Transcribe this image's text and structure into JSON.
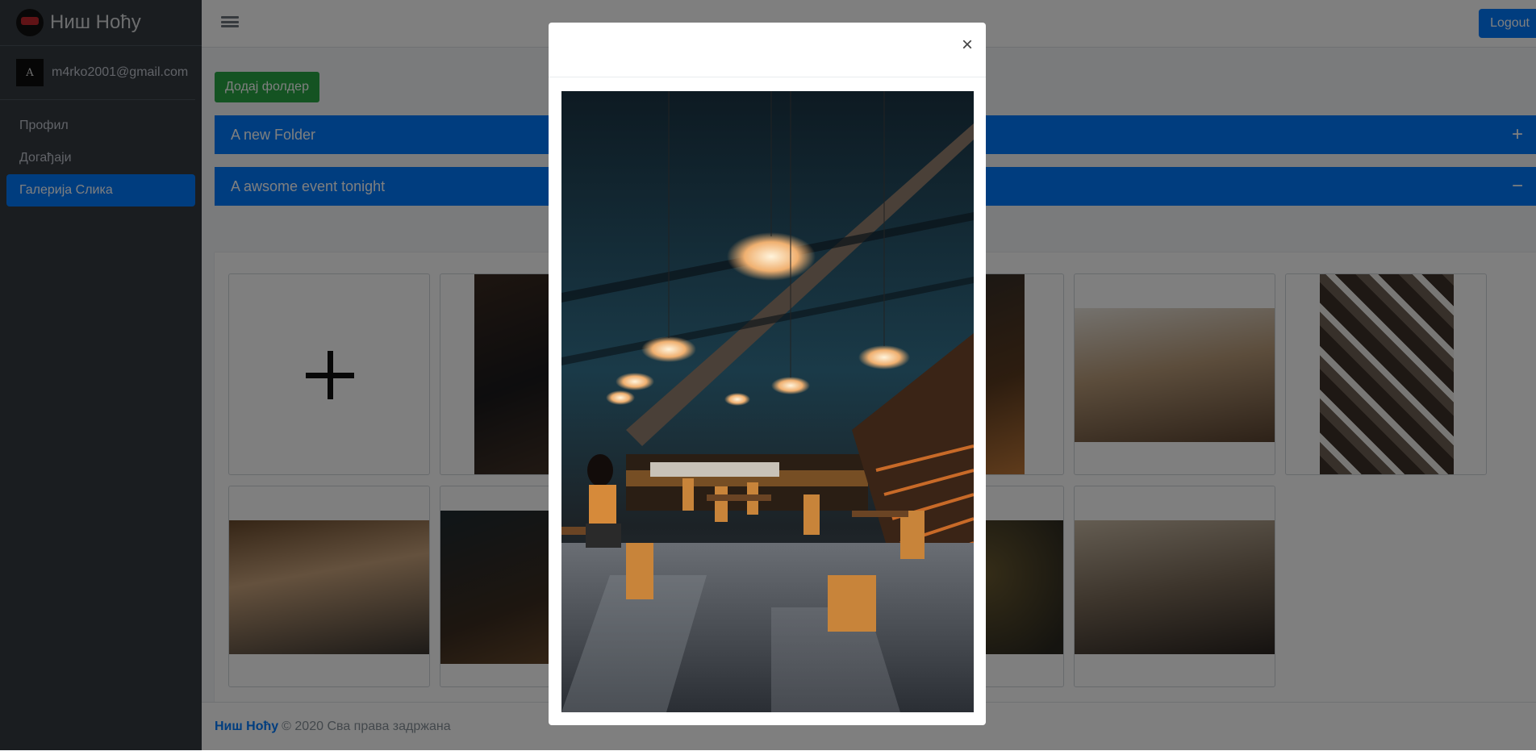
{
  "brand": {
    "name": "Ниш Ноћу"
  },
  "user": {
    "email": "m4rko2001@gmail.com",
    "avatar_letter": "A"
  },
  "nav": {
    "items": [
      {
        "label": "Профил",
        "active": false
      },
      {
        "label": "Догађаји",
        "active": false
      },
      {
        "label": "Галерија Слика",
        "active": true
      }
    ]
  },
  "topbar": {
    "logout_label": "Logout"
  },
  "gallery": {
    "add_folder_label": "Додај фолдер",
    "folders": [
      {
        "title": "A new Folder",
        "toggle": "+"
      },
      {
        "title": "A awsome event tonight",
        "toggle": "−"
      }
    ]
  },
  "footer": {
    "brand": "Ниш Ноћу",
    "text": "© 2020 Сва права задржана"
  },
  "modal": {
    "close_symbol": "×"
  },
  "colors": {
    "primary": "#007bff",
    "success": "#28a745",
    "sidebar": "#343a40"
  }
}
